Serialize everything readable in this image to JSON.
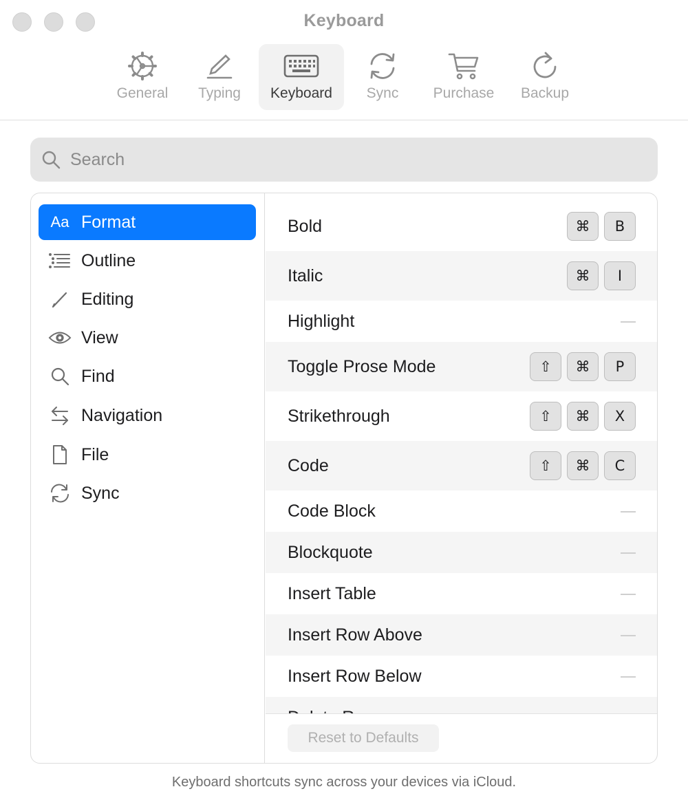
{
  "window": {
    "title": "Keyboard"
  },
  "toolbar": {
    "items": [
      {
        "label": "General",
        "icon": "gear-icon"
      },
      {
        "label": "Typing",
        "icon": "pencil-icon"
      },
      {
        "label": "Keyboard",
        "icon": "keyboard-icon",
        "active": true
      },
      {
        "label": "Sync",
        "icon": "sync-icon"
      },
      {
        "label": "Purchase",
        "icon": "cart-icon"
      },
      {
        "label": "Backup",
        "icon": "backup-icon"
      }
    ]
  },
  "search": {
    "placeholder": "Search",
    "value": ""
  },
  "sidebar": {
    "items": [
      {
        "label": "Format",
        "icon": "text-format-icon",
        "glyph": "Aa",
        "active": true
      },
      {
        "label": "Outline",
        "icon": "outline-list-icon"
      },
      {
        "label": "Editing",
        "icon": "pencil-icon"
      },
      {
        "label": "View",
        "icon": "eye-icon"
      },
      {
        "label": "Find",
        "icon": "magnifier-icon"
      },
      {
        "label": "Navigation",
        "icon": "arrows-left-right-icon"
      },
      {
        "label": "File",
        "icon": "document-icon"
      },
      {
        "label": "Sync",
        "icon": "sync-icon"
      }
    ]
  },
  "shortcuts": [
    {
      "label": "Bold",
      "keys": [
        "⌘",
        "B"
      ]
    },
    {
      "label": "Italic",
      "keys": [
        "⌘",
        "I"
      ]
    },
    {
      "label": "Highlight",
      "keys": []
    },
    {
      "label": "Toggle Prose Mode",
      "keys": [
        "⇧",
        "⌘",
        "P"
      ]
    },
    {
      "label": "Strikethrough",
      "keys": [
        "⇧",
        "⌘",
        "X"
      ]
    },
    {
      "label": "Code",
      "keys": [
        "⇧",
        "⌘",
        "C"
      ]
    },
    {
      "label": "Code Block",
      "keys": []
    },
    {
      "label": "Blockquote",
      "keys": []
    },
    {
      "label": "Insert Table",
      "keys": []
    },
    {
      "label": "Insert Row Above",
      "keys": []
    },
    {
      "label": "Insert Row Below",
      "keys": []
    },
    {
      "label": "Delete Row",
      "keys": []
    }
  ],
  "footer": {
    "reset_label": "Reset to Defaults",
    "note": "Keyboard shortcuts sync across your devices via iCloud."
  },
  "colors": {
    "accent": "#0a7aff",
    "row_alt": "#f5f5f5",
    "key_bg": "#e2e2e2"
  }
}
